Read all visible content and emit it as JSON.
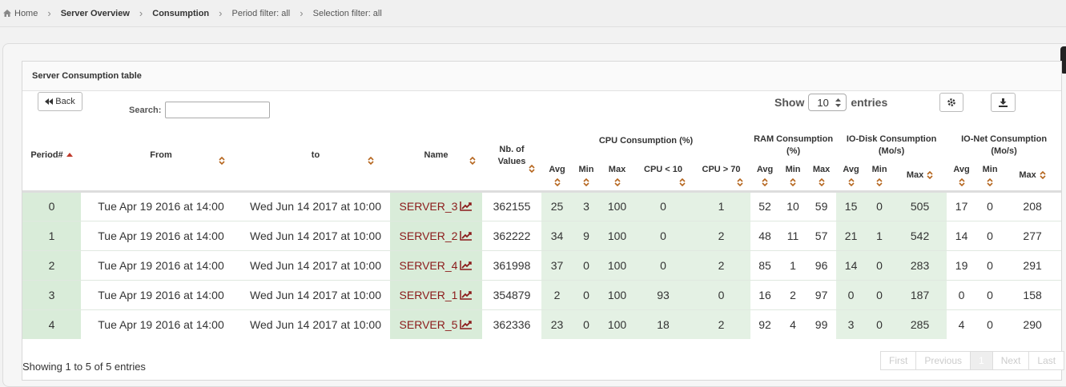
{
  "breadcrumb": {
    "home": "Home",
    "server_overview": "Server Overview",
    "consumption": "Consumption",
    "period_filter": "Period filter: all",
    "selection_filter": "Selection filter: all"
  },
  "panel": {
    "title": "Server Consumption table",
    "back_label": "Back",
    "search_label": "Search:",
    "search_value": "",
    "show_label": "Show",
    "entries_value": "10",
    "entries_label": "entries"
  },
  "columns": {
    "period": "Period#",
    "from": "From",
    "to": "to",
    "name": "Name",
    "nb_values": "Nb. of Values",
    "cpu": "CPU Consumption (%)",
    "ram": "RAM Consumption (%)",
    "iodisk": "IO-Disk Consumption (Mo/s)",
    "ionet": "IO-Net Consumption (Mo/s)",
    "avg": "Avg",
    "min": "Min",
    "max": "Max",
    "cpu_lt10": "CPU < 10",
    "cpu_gt70": "CPU > 70"
  },
  "rows": [
    {
      "period": "0",
      "from": "Tue Apr 19 2016 at 14:00",
      "to": "Wed Jun 14 2017 at 10:00",
      "name": "SERVER_3",
      "nb": "362155",
      "cpu_avg": "25",
      "cpu_min": "3",
      "cpu_max": "100",
      "cpu_lt10": "0",
      "cpu_gt70": "1",
      "ram_avg": "52",
      "ram_min": "10",
      "ram_max": "59",
      "disk_avg": "15",
      "disk_min": "0",
      "disk_max": "505",
      "net_avg": "17",
      "net_min": "0",
      "net_max": "208"
    },
    {
      "period": "1",
      "from": "Tue Apr 19 2016 at 14:00",
      "to": "Wed Jun 14 2017 at 10:00",
      "name": "SERVER_2",
      "nb": "362222",
      "cpu_avg": "34",
      "cpu_min": "9",
      "cpu_max": "100",
      "cpu_lt10": "0",
      "cpu_gt70": "2",
      "ram_avg": "48",
      "ram_min": "11",
      "ram_max": "57",
      "disk_avg": "21",
      "disk_min": "1",
      "disk_max": "542",
      "net_avg": "14",
      "net_min": "0",
      "net_max": "277"
    },
    {
      "period": "2",
      "from": "Tue Apr 19 2016 at 14:00",
      "to": "Wed Jun 14 2017 at 10:00",
      "name": "SERVER_4",
      "nb": "361998",
      "cpu_avg": "37",
      "cpu_min": "0",
      "cpu_max": "100",
      "cpu_lt10": "0",
      "cpu_gt70": "2",
      "ram_avg": "85",
      "ram_min": "1",
      "ram_max": "96",
      "disk_avg": "14",
      "disk_min": "0",
      "disk_max": "283",
      "net_avg": "19",
      "net_min": "0",
      "net_max": "291"
    },
    {
      "period": "3",
      "from": "Tue Apr 19 2016 at 14:00",
      "to": "Wed Jun 14 2017 at 10:00",
      "name": "SERVER_1",
      "nb": "354879",
      "cpu_avg": "2",
      "cpu_min": "0",
      "cpu_max": "100",
      "cpu_lt10": "93",
      "cpu_gt70": "0",
      "ram_avg": "16",
      "ram_min": "2",
      "ram_max": "97",
      "disk_avg": "0",
      "disk_min": "0",
      "disk_max": "187",
      "net_avg": "0",
      "net_min": "0",
      "net_max": "158"
    },
    {
      "period": "4",
      "from": "Tue Apr 19 2016 at 14:00",
      "to": "Wed Jun 14 2017 at 10:00",
      "name": "SERVER_5",
      "nb": "362336",
      "cpu_avg": "23",
      "cpu_min": "0",
      "cpu_max": "100",
      "cpu_lt10": "18",
      "cpu_gt70": "2",
      "ram_avg": "92",
      "ram_min": "4",
      "ram_max": "99",
      "disk_avg": "3",
      "disk_min": "0",
      "disk_max": "285",
      "net_avg": "4",
      "net_min": "0",
      "net_max": "290"
    }
  ],
  "footer": {
    "info": "Showing 1 to 5 of 5 entries",
    "first": "First",
    "previous": "Previous",
    "page": "1",
    "next": "Next",
    "last": "Last"
  },
  "colors": {
    "link": "#8b1a1a",
    "sort_active": "#c0392b",
    "sort_idle": "#b5651d",
    "cell_green": "#d9ecd9"
  }
}
